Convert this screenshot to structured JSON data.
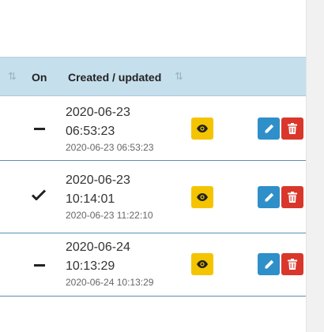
{
  "table": {
    "columns": {
      "on_label": "On",
      "created_label": "Created / updated"
    },
    "rows": [
      {
        "status": "off",
        "created_line1": "2020-06-23",
        "created_line2": "06:53:23",
        "updated": "2020-06-23 06:53:23"
      },
      {
        "status": "on",
        "created_line1": "2020-06-23",
        "created_line2": "10:14:01",
        "updated": "2020-06-23 11:22:10"
      },
      {
        "status": "off",
        "created_line1": "2020-06-24",
        "created_line2": "10:13:29",
        "updated": "2020-06-24 10:13:29"
      }
    ]
  },
  "icons": {
    "sort": "sort-icon",
    "view": "eye-icon",
    "edit": "pencil-icon",
    "delete": "trash-icon",
    "on": "check-icon",
    "off": "dash-icon"
  },
  "colors": {
    "header_bg": "#c6dfec",
    "view_button": "#f5c400",
    "edit_button": "#2f8fc9",
    "delete_button": "#d9372b"
  }
}
